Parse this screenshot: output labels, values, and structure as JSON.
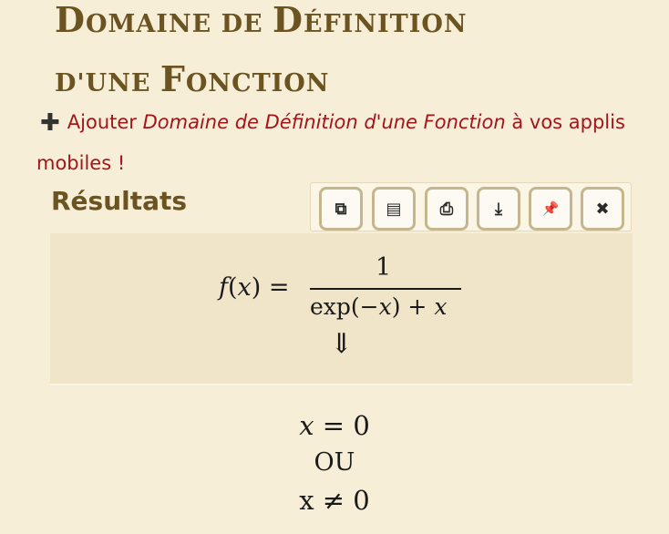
{
  "title": {
    "line1_big": "D",
    "line1_rest": "OMAINE DE ",
    "line1_big2": "D",
    "line1_rest2": "ÉFINITION",
    "line2_small": "D'UNE ",
    "line2_big": "F",
    "line2_rest": "ONCTION"
  },
  "promo": {
    "plus_icon": "plus-icon",
    "prefix": "Ajouter ",
    "app_name": "Domaine de Définition d'une Fonction",
    "suffix": " à vos applis mobiles !"
  },
  "results": {
    "label": "Résultats",
    "toolbar": [
      {
        "icon": "copy-icon",
        "glyph": "⧉"
      },
      {
        "icon": "scroll-icon",
        "glyph": "▤"
      },
      {
        "icon": "print-icon",
        "glyph": "⎙"
      },
      {
        "icon": "download-icon",
        "glyph": "⤓"
      },
      {
        "icon": "pin-icon",
        "glyph": "📌"
      },
      {
        "icon": "close-icon",
        "glyph": "✖"
      }
    ]
  },
  "formula": {
    "lhs_f": "f",
    "lhs_open": "(",
    "lhs_x": "x",
    "lhs_close": ") =",
    "numerator": "1",
    "den_exp": "exp(−",
    "den_x1": "x",
    "den_mid": ") + ",
    "den_x2": "x",
    "arrow": "⇓"
  },
  "result": {
    "line1_x": "x",
    "line1_rest": " = 0",
    "line2": "OU",
    "line3": "x ≠ 0"
  }
}
